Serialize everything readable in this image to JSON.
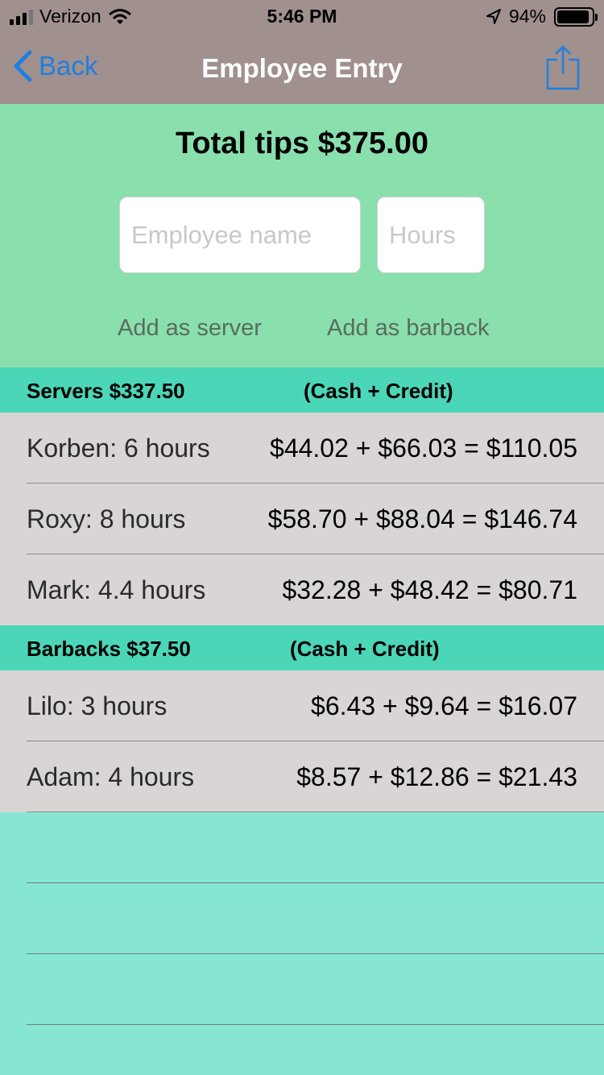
{
  "status_bar": {
    "carrier": "Verizon",
    "time": "5:46 PM",
    "battery": "94%",
    "battery_level": 0.94
  },
  "nav": {
    "back_label": "Back",
    "title": "Employee Entry"
  },
  "entry": {
    "total_tips": "Total tips $375.00",
    "name_placeholder": "Employee name",
    "hours_placeholder": "Hours",
    "add_server_label": "Add as server",
    "add_barback_label": "Add as barback"
  },
  "servers": {
    "header": "Servers  $337.50",
    "header_note": "(Cash + Credit)",
    "rows": [
      {
        "name": "Korben: 6 hours",
        "amount": "$44.02 + $66.03 = $110.05"
      },
      {
        "name": "Roxy: 8 hours",
        "amount": "$58.70 + $88.04 = $146.74"
      },
      {
        "name": "Mark: 4.4 hours",
        "amount": "$32.28 + $48.42 = $80.71"
      }
    ]
  },
  "barbacks": {
    "header": "Barbacks  $37.50",
    "header_note": "(Cash + Credit)",
    "rows": [
      {
        "name": "Lilo: 3 hours",
        "amount": "$6.43 + $9.64 = $16.07"
      },
      {
        "name": "Adam: 4 hours",
        "amount": "$8.57 + $12.86 = $21.43"
      }
    ]
  }
}
